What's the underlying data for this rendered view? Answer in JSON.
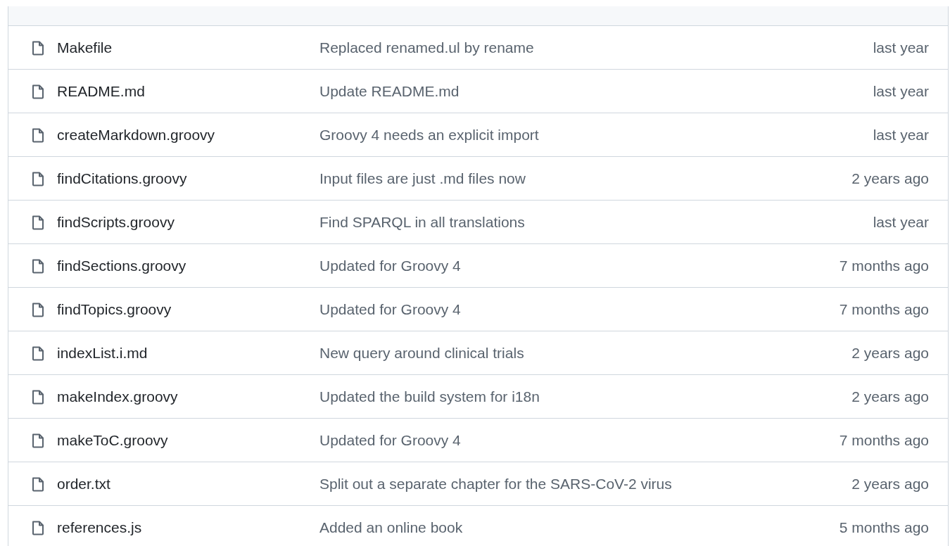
{
  "files": [
    {
      "name": "Makefile",
      "message": "Replaced renamed.ul by rename",
      "age": "last year"
    },
    {
      "name": "README.md",
      "message": "Update README.md",
      "age": "last year"
    },
    {
      "name": "createMarkdown.groovy",
      "message": "Groovy 4 needs an explicit import",
      "age": "last year"
    },
    {
      "name": "findCitations.groovy",
      "message": "Input files are just .md files now",
      "age": "2 years ago"
    },
    {
      "name": "findScripts.groovy",
      "message": "Find SPARQL in all translations",
      "age": "last year"
    },
    {
      "name": "findSections.groovy",
      "message": "Updated for Groovy 4",
      "age": "7 months ago"
    },
    {
      "name": "findTopics.groovy",
      "message": "Updated for Groovy 4",
      "age": "7 months ago"
    },
    {
      "name": "indexList.i.md",
      "message": "New query around clinical trials",
      "age": "2 years ago"
    },
    {
      "name": "makeIndex.groovy",
      "message": "Updated the build system for i18n",
      "age": "2 years ago"
    },
    {
      "name": "makeToC.groovy",
      "message": "Updated for Groovy 4",
      "age": "7 months ago"
    },
    {
      "name": "order.txt",
      "message": "Split out a separate chapter for the SARS-CoV-2 virus",
      "age": "2 years ago"
    },
    {
      "name": "references.js",
      "message": "Added an online book",
      "age": "5 months ago"
    }
  ]
}
